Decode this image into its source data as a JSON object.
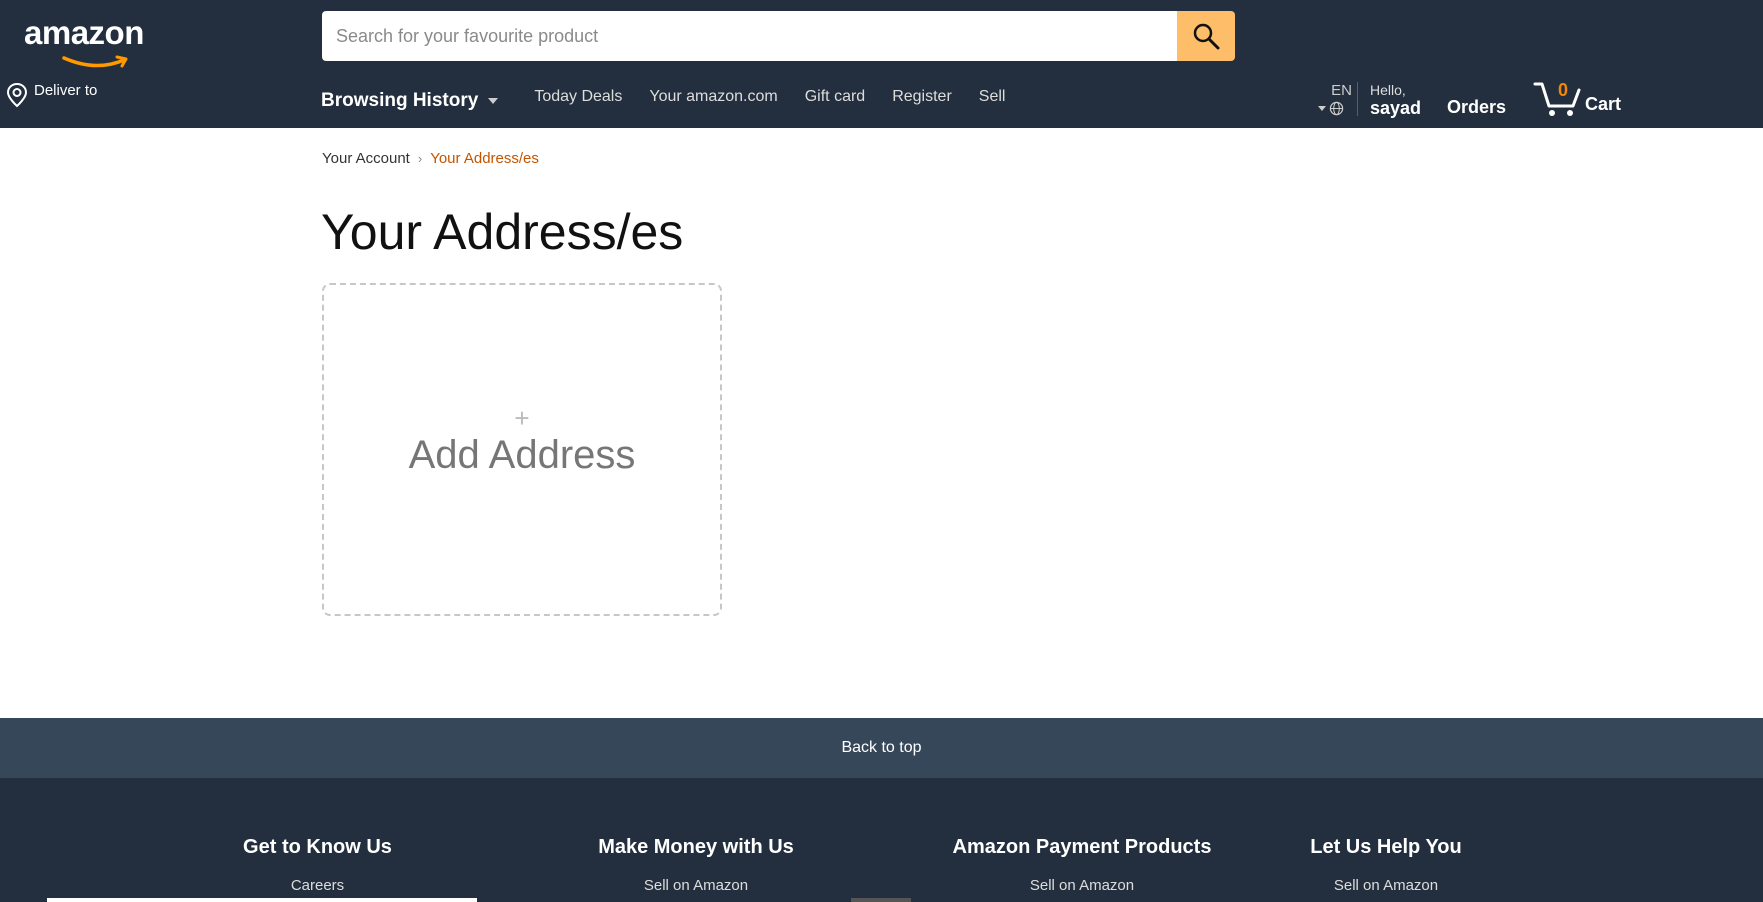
{
  "header": {
    "logo_text": "amazon",
    "search": {
      "placeholder": "Search for your favourite product"
    },
    "deliver_label": "Deliver to",
    "nav": {
      "history_label": "Browsing History",
      "links": [
        "Today Deals",
        "Your amazon.com",
        "Gift card",
        "Register",
        "Sell"
      ]
    },
    "language": "EN",
    "greeting": "Hello,",
    "username": "sayad",
    "orders_label": "Orders",
    "cart_count": "0",
    "cart_label": "Cart"
  },
  "breadcrumb": {
    "parent": "Your Account",
    "separator": "›",
    "current": "Your Address/es"
  },
  "main": {
    "title": "Your Address/es",
    "add_plus": "+",
    "add_label": "Add Address"
  },
  "back_to_top": "Back to top",
  "footer": {
    "columns": [
      {
        "heading": "Get to Know Us",
        "first_link": "Careers"
      },
      {
        "heading": "Make Money with Us",
        "first_link": "Sell on Amazon"
      },
      {
        "heading": "Amazon Payment Products",
        "first_link": "Sell on Amazon"
      },
      {
        "heading": "Let Us Help You",
        "first_link": "Sell on Amazon"
      }
    ]
  },
  "colors": {
    "header_bg": "#232f3e",
    "search_button": "#febd69",
    "breadcrumb_current": "#c45500",
    "cart_count": "#f08804",
    "back_to_top_bg": "#37475a"
  },
  "icons": [
    "search-icon",
    "location-pin-icon",
    "globe-icon",
    "cart-icon",
    "plus-icon"
  ]
}
